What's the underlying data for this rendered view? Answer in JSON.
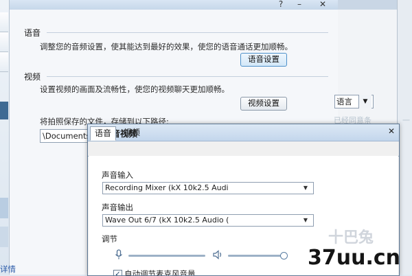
{
  "background_window": {
    "voice_section": {
      "label": "语音",
      "description": "调整您的音频设置，使其能达到最好的效果，使您的语音通话更加顺畅。",
      "button": "语音设置"
    },
    "video_section": {
      "label": "视频",
      "description": "设置视频的画面及流畅性，使您的视频聊天更加顺畅。",
      "button": "视频设置"
    },
    "photo_path_label": "将拍照保存的文件，存储到以下路径:",
    "photo_path_value": "\\Documents",
    "bottom_link": "详情",
    "title_controls": [
      "?",
      "–",
      "✕"
    ]
  },
  "right_pane": {
    "language_combo": "语言",
    "faded_text": "已经同意条",
    "faded_mark": "一"
  },
  "dialog": {
    "title": "语音视频",
    "close": "✕",
    "tabs": [
      {
        "label": "语音",
        "active": true
      },
      {
        "label": "视频",
        "active": false
      }
    ],
    "audio_input": {
      "label": "声音输入",
      "value": "Recording Mixer (kX 10k2.5 Audi"
    },
    "audio_output": {
      "label": "声音输出",
      "value": "Wave Out 6/7 (kX 10k2.5 Audio ("
    },
    "adjust_label": "调节",
    "auto_adjust_checkbox": "自动调节麦克风音量",
    "auto_adjust_checked": true
  },
  "watermark": {
    "text": "37uu.cn",
    "faint": "十巴兔"
  },
  "colors": {
    "accent": "#4d90c9",
    "dialog_border": "#5d7794",
    "sidebar_dark": "#3e6a93"
  }
}
